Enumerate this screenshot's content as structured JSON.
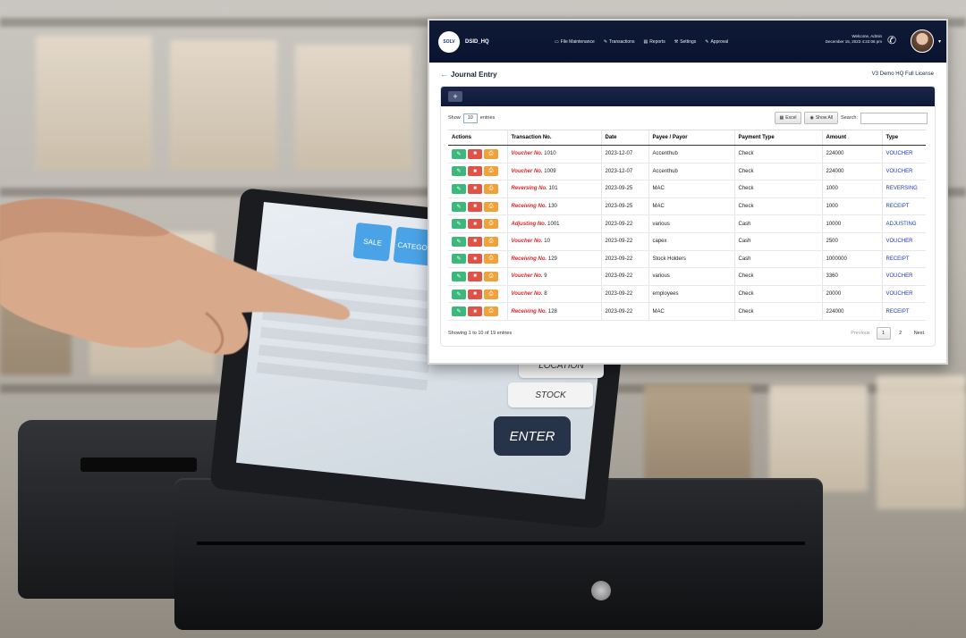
{
  "pos_screen": {
    "buttons": [
      "SALE",
      "CATEGORY"
    ],
    "side_buttons": [
      "LOCATION",
      "STOCK"
    ],
    "enter_label": "ENTER"
  },
  "nav": {
    "logo_text": "SOLV",
    "brand": "DSID_HQ",
    "menu": [
      {
        "label": "File Maintenance",
        "icon": "file-icon"
      },
      {
        "label": "Transactions",
        "icon": "edit-icon"
      },
      {
        "label": "Reports",
        "icon": "chart-icon"
      },
      {
        "label": "Settings",
        "icon": "wrench-icon"
      },
      {
        "label": "Approval",
        "icon": "edit-icon"
      }
    ],
    "welcome": "Welcome, Admin",
    "datetime": "December 15, 2023 4:22:06 pm"
  },
  "page": {
    "title": "Journal Entry",
    "license": "V3 Demo HQ Full License"
  },
  "controls": {
    "show_label": "Show",
    "page_length": "10",
    "entries_label": "entries",
    "excel_label": "Excel",
    "show_all_label": "Show All",
    "search_label": "Search:"
  },
  "table": {
    "headers": [
      "Actions",
      "Transaction No.",
      "Date",
      "Payee / Payor",
      "Payment Type",
      "Amount",
      "Type"
    ],
    "rows": [
      {
        "label": "Voucher No.",
        "no": "1010",
        "date": "2023-12-07",
        "payee": "Accenthub",
        "payment": "Check",
        "amount": "224000",
        "type": "VOUCHER"
      },
      {
        "label": "Voucher No.",
        "no": "1009",
        "date": "2023-12-07",
        "payee": "Accenthub",
        "payment": "Check",
        "amount": "224000",
        "type": "VOUCHER"
      },
      {
        "label": "Reversing No.",
        "no": "101",
        "date": "2023-09-25",
        "payee": "MAC",
        "payment": "Check",
        "amount": "1000",
        "type": "REVERSING"
      },
      {
        "label": "Receiving No.",
        "no": "130",
        "date": "2023-09-25",
        "payee": "MAC",
        "payment": "Check",
        "amount": "1000",
        "type": "RECEIPT"
      },
      {
        "label": "Adjusting No.",
        "no": "1001",
        "date": "2023-09-22",
        "payee": "various",
        "payment": "Cash",
        "amount": "10000",
        "type": "ADJUSTING"
      },
      {
        "label": "Voucher No.",
        "no": "10",
        "date": "2023-09-22",
        "payee": "capex",
        "payment": "Cash",
        "amount": "2500",
        "type": "VOUCHER"
      },
      {
        "label": "Receiving No.",
        "no": "129",
        "date": "2023-09-22",
        "payee": "Stock Holders",
        "payment": "Cash",
        "amount": "1000000",
        "type": "RECEIPT"
      },
      {
        "label": "Voucher No.",
        "no": "9",
        "date": "2023-09-22",
        "payee": "various",
        "payment": "Check",
        "amount": "3360",
        "type": "VOUCHER"
      },
      {
        "label": "Voucher No.",
        "no": "8",
        "date": "2023-09-22",
        "payee": "employees",
        "payment": "Check",
        "amount": "20000",
        "type": "VOUCHER"
      },
      {
        "label": "Receiving No.",
        "no": "128",
        "date": "2023-09-22",
        "payee": "MAC",
        "payment": "Check",
        "amount": "224000",
        "type": "RECEIPT"
      }
    ]
  },
  "footer": {
    "info": "Showing 1 to 10 of 19 entries",
    "previous": "Previous",
    "pages": [
      "1",
      "2"
    ],
    "next": "Next"
  },
  "colors": {
    "nav_bg": "#0f1a36",
    "edit": "#3cb97a",
    "delete": "#e05147",
    "print": "#f0a13a",
    "txn_label": "#d8262e",
    "type_link": "#1e39c7"
  }
}
